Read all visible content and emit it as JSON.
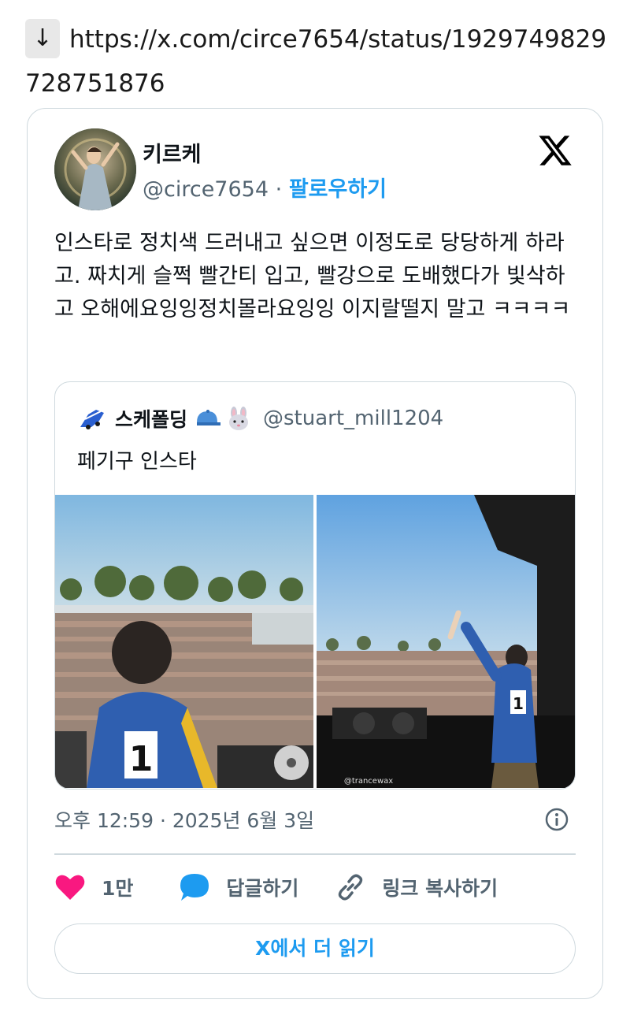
{
  "url_bar": {
    "download_icon": "↓",
    "url": "https://x.com/circe7654/status/1929749829728751876"
  },
  "tweet": {
    "display_name": "키르케",
    "handle": "@circe7654",
    "separator": "·",
    "follow_label": "팔로우하기",
    "text": "인스타로 정치색 드러내고 싶으면 이정도로 당당하게 하라고. 짜치게 슬쩍 빨간티 입고, 빨강으로 도배했다가 빛삭하고 오해에요잉잉정치몰라요잉잉 이지랄떨지 말고 ㅋㅋㅋㅋ",
    "timestamp": "오후 12:59 · 2025년 6월 3일",
    "like_count": "1만",
    "reply_label": "답글하기",
    "copy_link_label": "링크 복사하기",
    "read_more_label": "X에서 더 읽기",
    "colors": {
      "accent": "#1d9bf0",
      "like": "#f91880",
      "muted": "#536471",
      "border": "#cfd9de"
    }
  },
  "quote": {
    "display_name": "스케폴딩",
    "name_emoji_1": "blue-cap-emoji",
    "name_emoji_2": "rabbit-emoji",
    "handle": "@stuart_mill1204",
    "text": "페기구 인스타",
    "image_watermark": "@trancewax"
  },
  "icons": {
    "download": "down-arrow-icon",
    "x_logo": "x-logo-icon",
    "info": "info-icon",
    "like": "heart-icon",
    "reply": "speech-bubble-icon",
    "link": "link-icon"
  }
}
